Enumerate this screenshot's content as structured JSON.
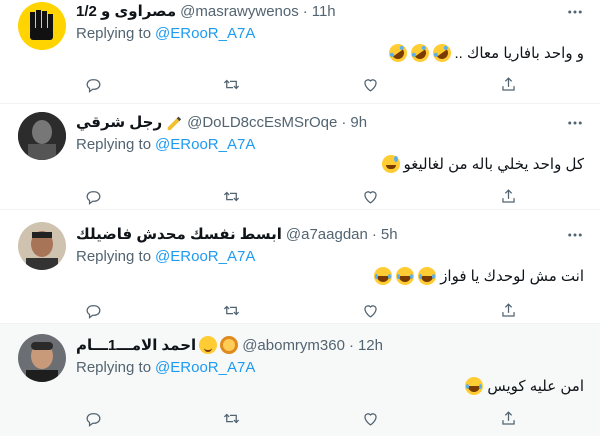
{
  "tweets": [
    {
      "display_name": "مصراوى و 1/2",
      "handle": "@masrawywenos",
      "dot": "·",
      "time": "11h",
      "replying_prefix": "Replying to",
      "replying_to": "@ERooR_A7A",
      "text": "و واحد بافاريا معاك ..",
      "emojis": [
        "rofl",
        "rofl",
        "rofl"
      ],
      "avatar": "yellow-four-finger-sign"
    },
    {
      "display_name": "رجل شرقي",
      "handle": "@DoLD8ccEsMSrOqe",
      "dot": "·",
      "time": "9h",
      "replying_prefix": "Replying to",
      "replying_to": "@ERooR_A7A",
      "text": "كل واحد يخلي باله من لغاليغو",
      "emojis": [
        "sweat-smile"
      ],
      "avatar": "dark-photo"
    },
    {
      "display_name": "ابسط نفسك محدش فاضيلك",
      "handle": "@a7aagdan",
      "dot": "·",
      "time": "5h",
      "replying_prefix": "Replying to",
      "replying_to": "@ERooR_A7A",
      "text": "انت مش لوحدك يا فواز",
      "emojis": [
        "joy",
        "joy",
        "joy"
      ],
      "avatar": "man-photo"
    },
    {
      "display_name": "احمد الامـــ1ـــام",
      "handle": "@abomrym360",
      "dot": "·",
      "time": "12h",
      "replying_prefix": "Replying to",
      "replying_to": "@ERooR_A7A",
      "text": "امن عليه كويس",
      "emojis": [
        "joy"
      ],
      "avatar": "man-photo-2"
    }
  ],
  "colors": {
    "link": "#1d9bf0",
    "muted": "#536471",
    "border": "#eff3f4",
    "highlight": "#f7f9f9"
  }
}
